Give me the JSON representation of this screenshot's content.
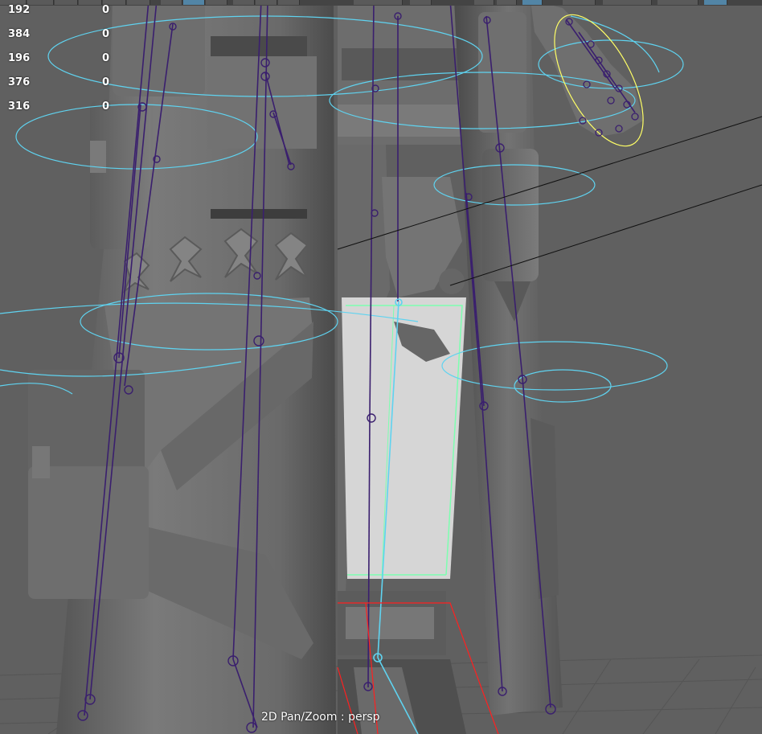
{
  "viewport": {
    "camera_label": "2D Pan/Zoom : persp"
  },
  "hud": {
    "rows": [
      {
        "label": "192",
        "value": "0"
      },
      {
        "label": "384",
        "value": "0"
      },
      {
        "label": "196",
        "value": "0"
      },
      {
        "label": "376",
        "value": "0"
      },
      {
        "label": "316",
        "value": "0"
      }
    ]
  },
  "colors": {
    "viewport_background": "#606060",
    "mesh_gray": "#6e6e6e",
    "joint_purple": "#3a1f6e",
    "control_cyan": "#5fd3f0",
    "selection_green": "#7dffb0",
    "selection_yellow": "#ffff66",
    "grid_red": "#ff2020",
    "active_tool_blue": "#5285a6"
  },
  "icons": [
    "move-tool-icon",
    "rotate-tool-icon",
    "scale-tool-icon",
    "snap-icon",
    "camera-icon"
  ]
}
